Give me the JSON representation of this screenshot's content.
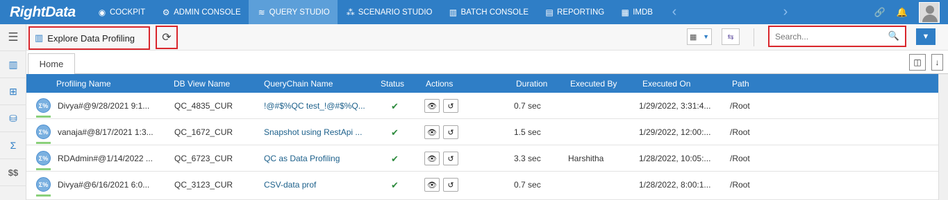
{
  "app": {
    "logo_text": "RightData"
  },
  "nav": {
    "items": [
      {
        "label": "COCKPIT",
        "icon": "cockpit-icon"
      },
      {
        "label": "ADMIN CONSOLE",
        "icon": "gear-icon"
      },
      {
        "label": "QUERY STUDIO",
        "icon": "database-icon",
        "active": true
      },
      {
        "label": "SCENARIO STUDIO",
        "icon": "scenario-icon"
      },
      {
        "label": "BATCH CONSOLE",
        "icon": "batch-icon"
      },
      {
        "label": "REPORTING",
        "icon": "report-icon"
      },
      {
        "label": "IMDB",
        "icon": "imdb-icon"
      }
    ],
    "prev_arrow": "‹",
    "next_arrow": "›"
  },
  "toolbar": {
    "explore_label": "Explore Data Profiling",
    "search_placeholder": "Search...",
    "search_value": ""
  },
  "tabs": {
    "home": "Home"
  },
  "table": {
    "headers": {
      "profiling_name": "Profiling Name",
      "db_view_name": "DB View Name",
      "querychain_name": "QueryChain Name",
      "status": "Status",
      "actions": "Actions",
      "duration": "Duration",
      "executed_by": "Executed By",
      "executed_on": "Executed On",
      "path": "Path"
    },
    "rows": [
      {
        "profiling_name": "Divya#@9/28/2021 9:1...",
        "db_view_name": "QC_4835_CUR",
        "querychain_name": "!@#$%QC test_!@#$%Q...",
        "status": "✔",
        "duration": "0.7 sec",
        "executed_by": "",
        "executed_on": "1/29/2022, 3:31:4...",
        "path": "/Root"
      },
      {
        "profiling_name": "vanaja#@8/17/2021 1:3...",
        "db_view_name": "QC_1672_CUR",
        "querychain_name": "Snapshot using RestApi ...",
        "status": "✔",
        "duration": "1.5 sec",
        "executed_by": "",
        "executed_on": "1/29/2022, 12:00:...",
        "path": "/Root"
      },
      {
        "profiling_name": "RDAdmin#@1/14/2022 ...",
        "db_view_name": "QC_6723_CUR",
        "querychain_name": "QC as Data Profiling",
        "status": "✔",
        "duration": "3.3 sec",
        "executed_by": "Harshitha",
        "executed_on": "1/28/2022, 10:05:...",
        "path": "/Root"
      },
      {
        "profiling_name": "Divya#@6/16/2021 6:0...",
        "db_view_name": "QC_3123_CUR",
        "querychain_name": "CSV-data prof",
        "status": "✔",
        "duration": "0.7 sec",
        "executed_by": "",
        "executed_on": "1/28/2022, 8:00:1...",
        "path": "/Root"
      }
    ],
    "row_icon_text": "Σ%",
    "view_icon": "👁",
    "history_icon": "↺"
  },
  "sidebar": {
    "items": [
      "menu-icon",
      "explore-data-icon",
      "add-table-icon",
      "database-view-icon",
      "data-profiling-icon",
      "dollar-icon"
    ],
    "dollar_text": "$$"
  },
  "colors": {
    "brand": "#2f7ec6",
    "highlight": "#d9262c",
    "status_ok": "#2e8b3e",
    "link": "#1b5f8a"
  }
}
